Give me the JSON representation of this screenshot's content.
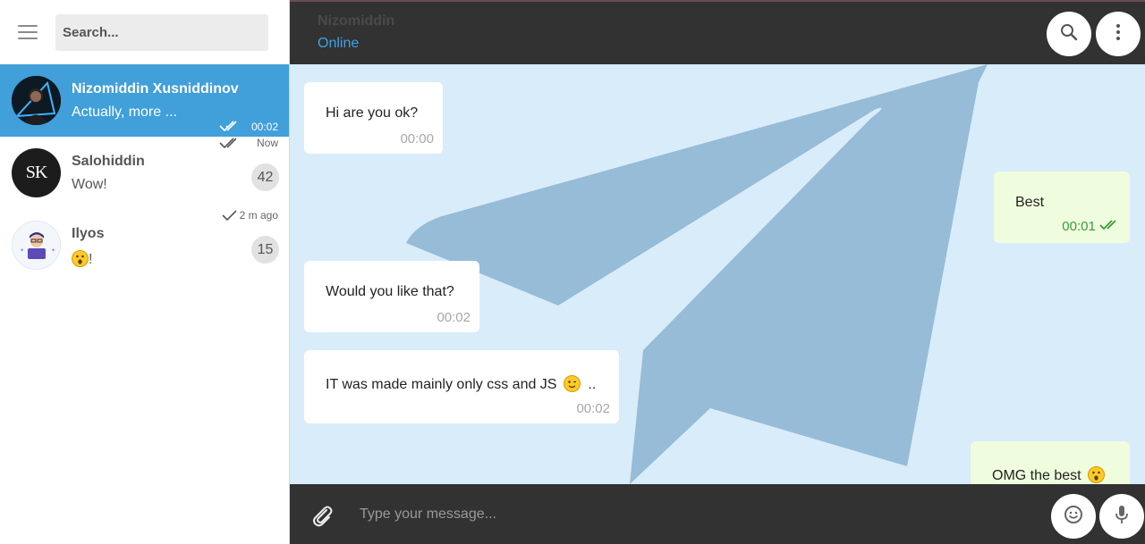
{
  "sidebar": {
    "search": {
      "placeholder": "Search..."
    },
    "chats": [
      {
        "name": "Nizomiddin Xusniddinov",
        "last_message": "Actually, more ...",
        "time": "00:02",
        "read_status": "double-check",
        "active": true
      },
      {
        "name": "Salohiddin",
        "last_message": "Wow!",
        "time": "Now",
        "read_status": "double-check",
        "unread_count": "42",
        "avatar_text": "SK"
      },
      {
        "name": "Ilyos",
        "last_message": "!",
        "last_message_emoji": "astonished-face",
        "time": "2 m ago",
        "read_status": "single-check",
        "unread_count": "15"
      }
    ]
  },
  "header": {
    "contact_name": "Nizomiddin",
    "status": "Online",
    "search_icon": "search-icon",
    "menu_icon": "more-vertical-icon"
  },
  "messages": [
    {
      "direction": "incoming",
      "text": "Hi are you ok?",
      "time": "00:00"
    },
    {
      "direction": "outgoing",
      "text": "Best",
      "time": "00:01",
      "read_status": "double-check"
    },
    {
      "direction": "incoming",
      "text": "Would you like that?",
      "time": "00:02"
    },
    {
      "direction": "incoming",
      "text": "IT was made mainly only css and JS",
      "text_suffix": "..",
      "emoji": "winking-face",
      "time": "00:02"
    },
    {
      "direction": "outgoing",
      "text": "OMG the best",
      "emoji": "astonished-face"
    }
  ],
  "composer": {
    "placeholder": "Type your message...",
    "attach_icon": "paperclip-icon",
    "emoji_icon": "smiley-icon",
    "mic_icon": "microphone-icon"
  },
  "colors": {
    "accent": "#419fd9",
    "topbar": "#323232",
    "chat_bg": "#d9ecfa",
    "outgoing_bubble": "#effdde",
    "status_online": "#3da2e6",
    "read_tick": "#3a9b3a"
  }
}
